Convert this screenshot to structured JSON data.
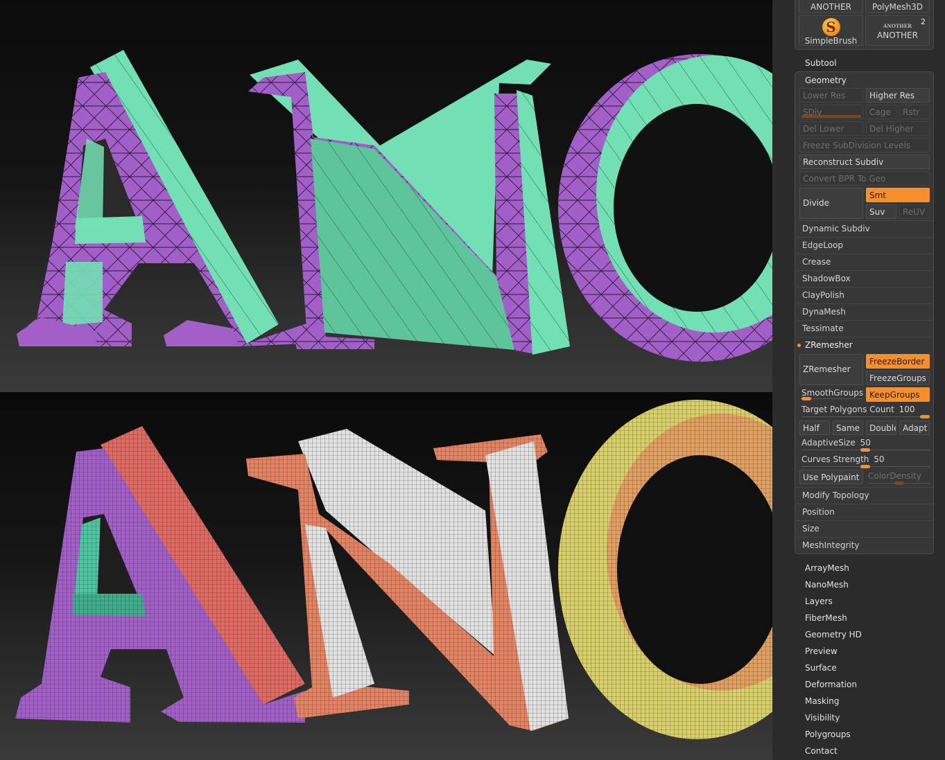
{
  "tools": {
    "t1": "ANOTHER",
    "t2": "PolyMesh3D",
    "t3": "SimpleBrush",
    "t4": "ANOTHER",
    "t4_thumb": "ANOTHER",
    "t4_badge": "2"
  },
  "subtool": "Subtool",
  "geometry": {
    "title": "Geometry",
    "lower_res": "Lower Res",
    "higher_res": "Higher Res",
    "sdiv": "SDiv",
    "cage": "Cage",
    "rstr": "Rstr",
    "del_lower": "Del Lower",
    "del_higher": "Del Higher",
    "freeze_subdiv": "Freeze SubDivision Levels",
    "reconstruct": "Reconstruct Subdiv",
    "convert_bpr": "Convert BPR To Geo",
    "divide": "Divide",
    "smt": "Smt",
    "suv": "Suv",
    "reuv": "ReUV",
    "sections": [
      "Dynamic Subdiv",
      "EdgeLoop",
      "Crease",
      "ShadowBox",
      "ClayPolish",
      "DynaMesh",
      "Tessimate"
    ],
    "zremesher_title": "ZRemesher",
    "zremesher_btn": "ZRemesher",
    "freeze_border": "FreezeBorder",
    "freeze_groups": "FreezeGroups",
    "smooth_groups": "SmoothGroups",
    "keep_groups": "KeepGroups",
    "target_label": "Target Polygons Count",
    "target_value": "100",
    "half": "Half",
    "same": "Same",
    "double": "Double",
    "adapt": "Adapt",
    "adaptive_label": "AdaptiveSize",
    "adaptive_value": "50",
    "curves_label": "Curves Strength",
    "curves_value": "50",
    "use_polypaint": "Use Polypaint",
    "color_density": "ColorDensity",
    "sections2": [
      "Modify Topology",
      "Position",
      "Size",
      "MeshIntegrity"
    ]
  },
  "menus": [
    "ArrayMesh",
    "NanoMesh",
    "Layers",
    "FiberMesh",
    "Geometry HD",
    "Preview",
    "Surface",
    "Deformation",
    "Masking",
    "Visibility",
    "Polygroups",
    "Contact"
  ],
  "colors": {
    "accent": "#f7902b",
    "top_front": "#a35fc8",
    "top_side": "#72e0b4",
    "bottom_purple": "#a35fc8",
    "bottom_red": "#e06a62",
    "bottom_orange": "#e58462",
    "bottom_white": "#e2e2e2",
    "bottom_yellow": "#e5e27a"
  }
}
